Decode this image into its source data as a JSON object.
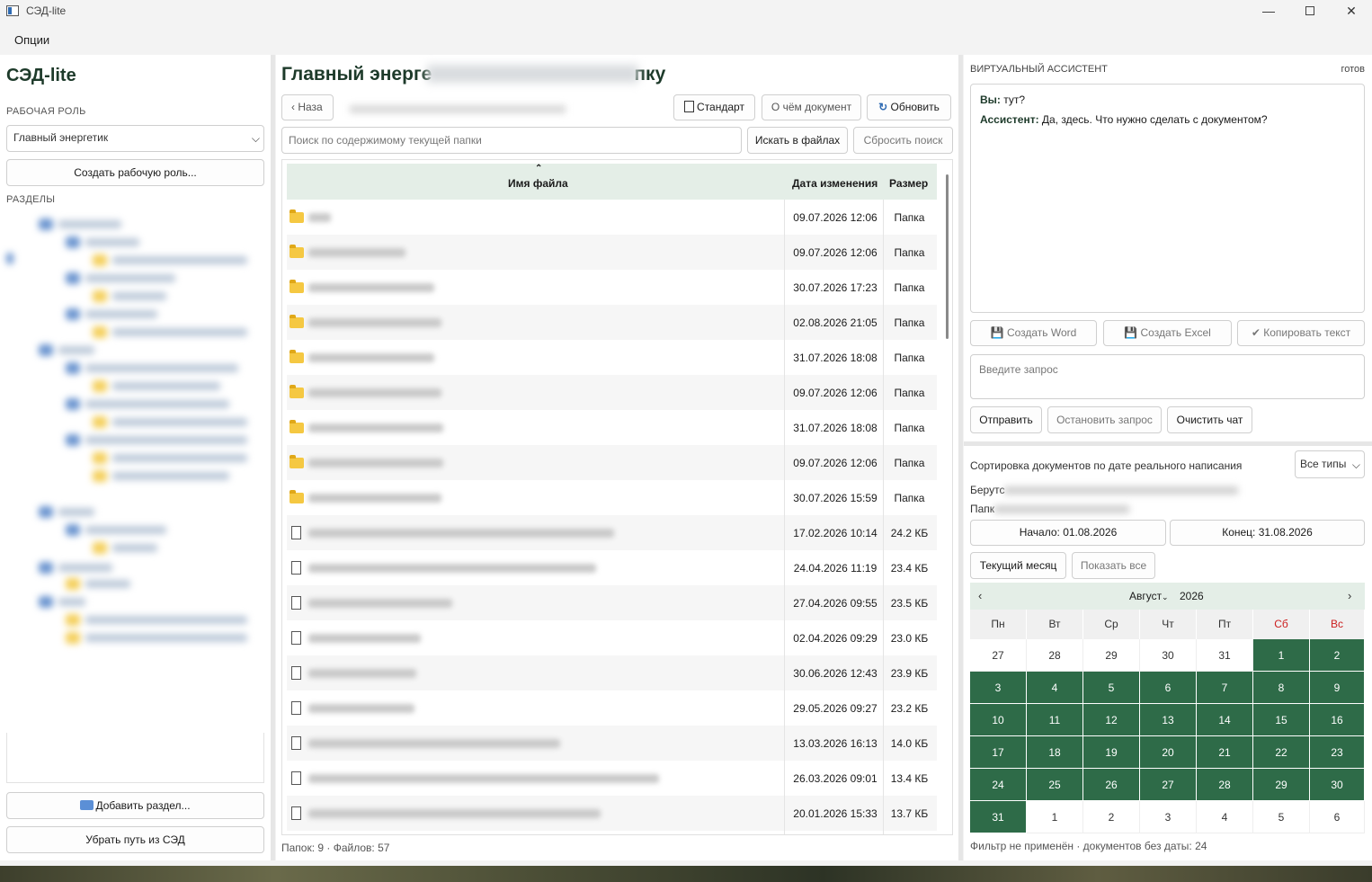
{
  "window": {
    "title": "СЭД-lite",
    "min": "—",
    "close": "✕"
  },
  "menu": {
    "options": "Опции"
  },
  "left": {
    "app_title": "СЭД-lite",
    "role_label": "РАБОЧАЯ РОЛЬ",
    "role_value": "Главный энергетик",
    "create_role": "Создать рабочую роль...",
    "sections_label": "РАЗДЕЛЫ",
    "add_section": "Добавить раздел...",
    "remove_path": "Убрать путь из СЭД"
  },
  "main": {
    "title_start": "Главный энерге",
    "title_end": "пку",
    "back": "Наза",
    "standard": "Стандарт",
    "about_doc": "О чём документ",
    "refresh": "Обновить",
    "search_placeholder": "Поиск по содержимому текущей папки",
    "search_files": "Искать в файлах",
    "reset_search": "Сбросить поиск",
    "columns": {
      "name": "Имя файла",
      "date": "Дата изменения",
      "size": "Размер"
    },
    "rows": [
      {
        "type": "folder",
        "date": "09.07.2026 12:06",
        "size": "Папка"
      },
      {
        "type": "folder",
        "date": "09.07.2026 12:06",
        "size": "Папка"
      },
      {
        "type": "folder",
        "date": "30.07.2026 17:23",
        "size": "Папка"
      },
      {
        "type": "folder",
        "date": "02.08.2026 21:05",
        "size": "Папка"
      },
      {
        "type": "folder",
        "date": "31.07.2026 18:08",
        "size": "Папка"
      },
      {
        "type": "folder",
        "date": "09.07.2026 12:06",
        "size": "Папка"
      },
      {
        "type": "folder",
        "date": "31.07.2026 18:08",
        "size": "Папка"
      },
      {
        "type": "folder",
        "date": "09.07.2026 12:06",
        "size": "Папка"
      },
      {
        "type": "folder",
        "date": "30.07.2026 15:59",
        "size": "Папка"
      },
      {
        "type": "file",
        "date": "17.02.2026 10:14",
        "size": "24.2 КБ"
      },
      {
        "type": "file",
        "date": "24.04.2026 11:19",
        "size": "23.4 КБ"
      },
      {
        "type": "file",
        "date": "27.04.2026 09:55",
        "size": "23.5 КБ"
      },
      {
        "type": "file",
        "date": "02.04.2026 09:29",
        "size": "23.0 КБ"
      },
      {
        "type": "file",
        "date": "30.06.2026 12:43",
        "size": "23.9 КБ"
      },
      {
        "type": "file",
        "date": "29.05.2026 09:27",
        "size": "23.2 КБ"
      },
      {
        "type": "file",
        "date": "13.03.2026 16:13",
        "size": "14.0 КБ"
      },
      {
        "type": "file",
        "date": "26.03.2026 09:01",
        "size": "13.4 КБ"
      },
      {
        "type": "file",
        "date": "20.01.2026 15:33",
        "size": "13.7 КБ"
      }
    ],
    "status": "Папок: 9 · Файлов: 57"
  },
  "assistant": {
    "label": "ВИРТУАЛЬНЫЙ АССИСТЕНТ",
    "status": "готов",
    "you_label": "Вы:",
    "you_text": " тут?",
    "bot_label": "Ассистент:",
    "bot_text": " Да, здесь. Что нужно сделать с документом?",
    "create_word": "Создать Word",
    "create_excel": "Создать Excel",
    "copy_text": "Копировать текст",
    "query_placeholder": "Введите запрос",
    "send": "Отправить",
    "stop": "Остановить запрос",
    "clear": "Очистить чат"
  },
  "sorting": {
    "label": "Сортировка документов по дате реального написания",
    "type_value": "Все типы",
    "info1_prefix": "Берутс",
    "info2_prefix": "Папк",
    "start": "Начало: 01.08.2026",
    "end": "Конец: 31.08.2026",
    "current_month": "Текущий месяц",
    "show_all": "Показать все",
    "filter_status": "Фильтр не применён · документов без даты: 24"
  },
  "calendar": {
    "month": "Август",
    "year": "2026",
    "prev": "‹",
    "next": "›",
    "weekdays": [
      "Пн",
      "Вт",
      "Ср",
      "Чт",
      "Пт",
      "Сб",
      "Вс"
    ],
    "weeks": [
      [
        "27",
        "28",
        "29",
        "30",
        "31",
        "1",
        "2"
      ],
      [
        "3",
        "4",
        "5",
        "6",
        "7",
        "8",
        "9"
      ],
      [
        "10",
        "11",
        "12",
        "13",
        "14",
        "15",
        "16"
      ],
      [
        "17",
        "18",
        "19",
        "20",
        "21",
        "22",
        "23"
      ],
      [
        "24",
        "25",
        "26",
        "27",
        "28",
        "29",
        "30"
      ],
      [
        "31",
        "1",
        "2",
        "3",
        "4",
        "5",
        "6"
      ]
    ],
    "selected_range": "01.08.2026–31.08.2026"
  }
}
